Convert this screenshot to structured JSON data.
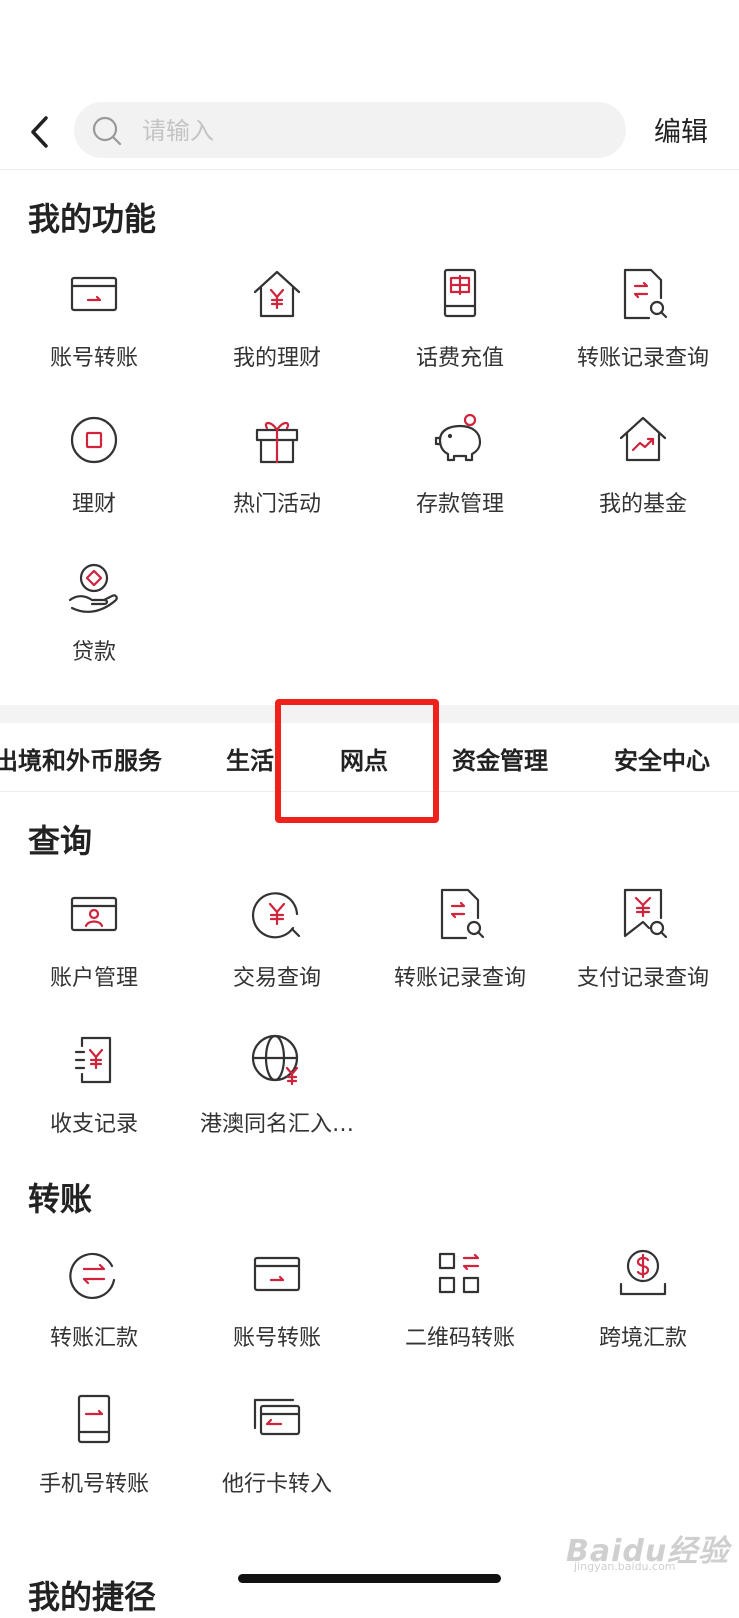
{
  "header": {
    "search_placeholder": "请输入",
    "edit_label": "编辑"
  },
  "my_functions": {
    "title": "我的功能",
    "items": [
      {
        "label": "账号转账",
        "icon": "card-transfer-icon"
      },
      {
        "label": "我的理财",
        "icon": "house-yuan-icon"
      },
      {
        "label": "话费充值",
        "icon": "phone-hui-icon"
      },
      {
        "label": "转账记录查询",
        "icon": "doc-transfer-search-icon"
      },
      {
        "label": "理财",
        "icon": "circle-square-icon"
      },
      {
        "label": "热门活动",
        "icon": "gift-icon"
      },
      {
        "label": "存款管理",
        "icon": "piggy-bank-icon"
      },
      {
        "label": "我的基金",
        "icon": "house-chart-icon"
      },
      {
        "label": "贷款",
        "icon": "hand-coin-icon"
      }
    ]
  },
  "tabs": [
    {
      "label": "出境和外币服务"
    },
    {
      "label": "生活"
    },
    {
      "label": "网点"
    },
    {
      "label": "资金管理"
    },
    {
      "label": "安全中心"
    }
  ],
  "query": {
    "title": "查询",
    "items": [
      {
        "label": "账户管理",
        "icon": "card-user-icon"
      },
      {
        "label": "交易查询",
        "icon": "yuan-search-icon"
      },
      {
        "label": "转账记录查询",
        "icon": "doc-transfer-search-icon"
      },
      {
        "label": "支付记录查询",
        "icon": "bookmark-yuan-search-icon"
      },
      {
        "label": "收支记录",
        "icon": "list-yuan-icon"
      },
      {
        "label": "港澳同名汇入…",
        "icon": "globe-yuan-icon"
      }
    ]
  },
  "transfer": {
    "title": "转账",
    "items": [
      {
        "label": "转账汇款",
        "icon": "circle-arrows-icon"
      },
      {
        "label": "账号转账",
        "icon": "card-transfer-icon"
      },
      {
        "label": "二维码转账",
        "icon": "qr-transfer-icon"
      },
      {
        "label": "跨境汇款",
        "icon": "dollar-coin-icon"
      },
      {
        "label": "手机号转账",
        "icon": "phone-transfer-icon"
      },
      {
        "label": "他行卡转入",
        "icon": "cards-in-icon"
      }
    ]
  },
  "next_section": {
    "title": "我的捷径"
  },
  "watermark": {
    "text": "Baidu经验",
    "sub": "jingyan.baidu.com"
  },
  "colors": {
    "accent": "#d0243c",
    "highlight": "#f0201b"
  }
}
